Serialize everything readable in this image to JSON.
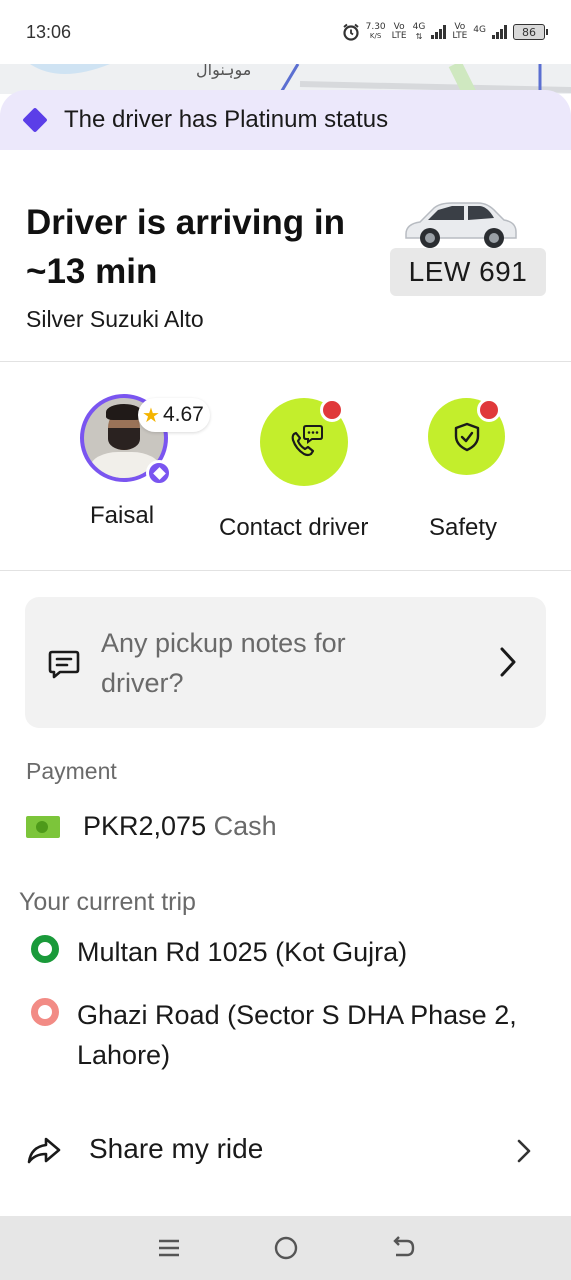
{
  "status_bar": {
    "time": "13:06",
    "net_speed_value": "7.30",
    "net_speed_unit": "K/S",
    "sim1_vo": "Vo",
    "sim1_lte": "LTE",
    "sim1_gen": "4G",
    "sim2_vo": "Vo",
    "sim2_lte": "LTE",
    "sim2_gen": "4G",
    "battery": "86"
  },
  "map": {
    "label": "موہنوال"
  },
  "banner": {
    "text": "The driver has Platinum status",
    "icon": "diamond-icon",
    "color": "#5b3ee8"
  },
  "arrival": {
    "title": "Driver is arriving in ~13 min",
    "car_model": "Silver Suzuki Alto",
    "plate": "LEW 691"
  },
  "driver": {
    "name": "Faisal",
    "rating": "4.67"
  },
  "actions": {
    "contact_label": "Contact driver",
    "safety_label": "Safety",
    "accent": "#c3ee2c",
    "notification_color": "#e0393a"
  },
  "notes": {
    "placeholder": "Any pickup notes for driver?"
  },
  "payment": {
    "heading": "Payment",
    "amount": "PKR2,075",
    "method": "Cash"
  },
  "trip": {
    "heading": "Your current trip",
    "pickup": "Multan Rd 1025 (Kot Gujra)",
    "dropoff": "Ghazi Road (Sector S DHA Phase 2, Lahore)"
  },
  "share": {
    "label": "Share my ride"
  }
}
